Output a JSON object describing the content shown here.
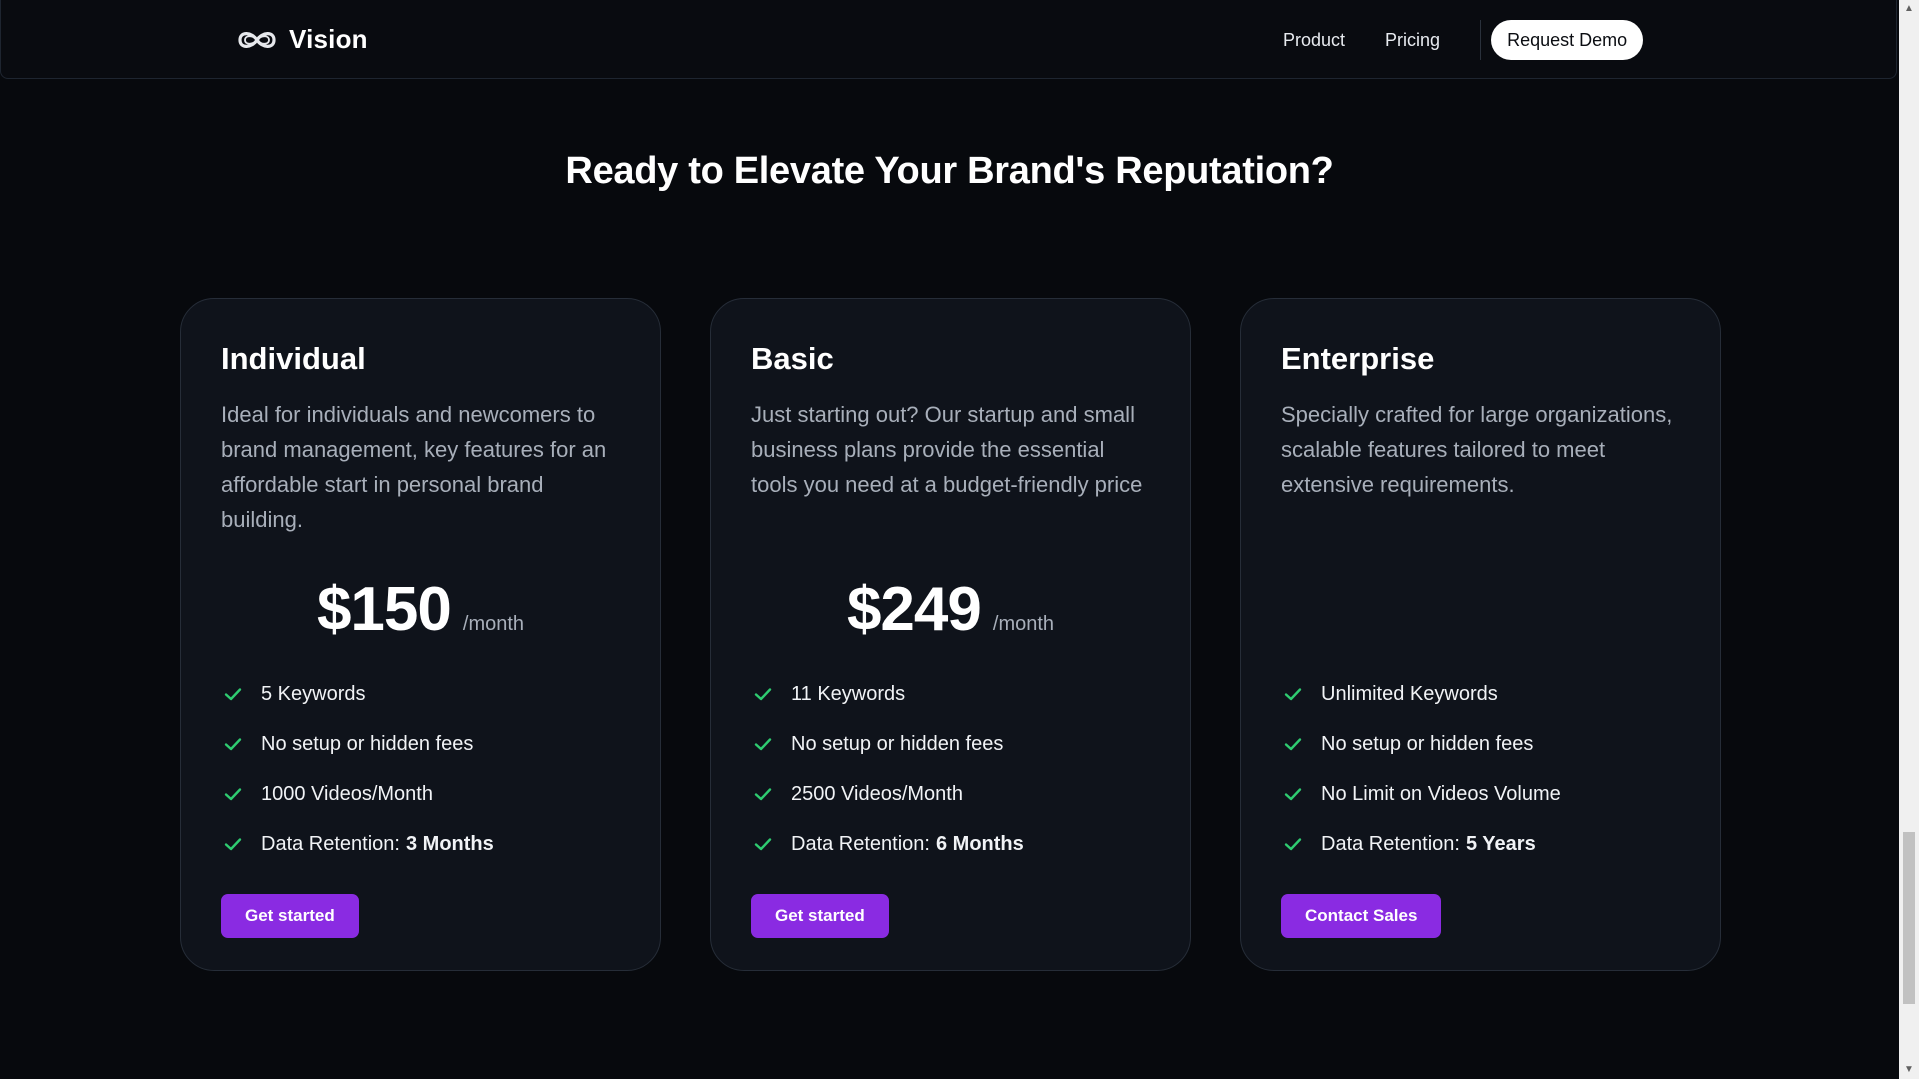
{
  "brand": {
    "name": "Vision"
  },
  "nav": {
    "product": "Product",
    "pricing": "Pricing",
    "demo": "Request Demo"
  },
  "headline": "Ready to Elevate Your Brand's Reputation?",
  "colors": {
    "background": "#07090d",
    "card": "#0f131b",
    "accent": "#8a2be2",
    "check": "#2ecc71"
  },
  "plans": [
    {
      "name": "Individual",
      "description": "Ideal for individuals and newcomers to brand management, key features for an affordable start in personal brand building.",
      "price": "$150",
      "period": "/month",
      "features": [
        {
          "text": "5 Keywords",
          "bold": ""
        },
        {
          "text": "No setup or hidden fees",
          "bold": ""
        },
        {
          "text": "1000 Videos/Month",
          "bold": ""
        },
        {
          "text": "Data Retention:",
          "bold": "3 Months"
        }
      ],
      "cta": "Get started"
    },
    {
      "name": "Basic",
      "description": "Just starting out? Our startup and small business plans provide the essential tools you need at a budget-friendly price",
      "price": "$249",
      "period": "/month",
      "features": [
        {
          "text": "11 Keywords",
          "bold": ""
        },
        {
          "text": "No setup or hidden fees",
          "bold": ""
        },
        {
          "text": "2500 Videos/Month",
          "bold": ""
        },
        {
          "text": "Data Retention:",
          "bold": "6 Months"
        }
      ],
      "cta": "Get started"
    },
    {
      "name": "Enterprise",
      "description": "Specially crafted for large organizations, scalable features tailored to meet extensive requirements.",
      "price": "",
      "period": "",
      "features": [
        {
          "text": "Unlimited Keywords",
          "bold": ""
        },
        {
          "text": "No setup or hidden fees",
          "bold": ""
        },
        {
          "text": "No Limit on Videos Volume",
          "bold": ""
        },
        {
          "text": "Data Retention:",
          "bold": "5 Years"
        }
      ],
      "cta": "Contact Sales"
    }
  ],
  "icons": {
    "logo": "infinity-logo-icon",
    "check": "check-icon"
  }
}
